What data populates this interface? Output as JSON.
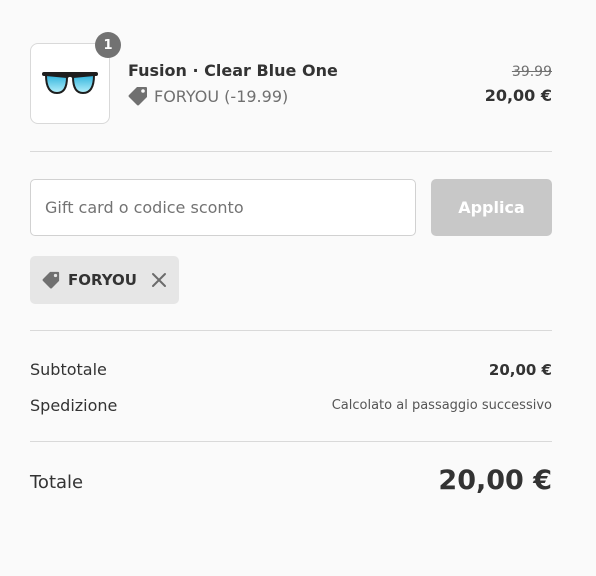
{
  "product": {
    "quantity": "1",
    "name": "Fusion · Clear Blue One",
    "discount_line": "FORYOU (-19.99)",
    "original_price": "39.99",
    "price": "20,00 €",
    "image_icon": "sunglasses-icon"
  },
  "discount": {
    "placeholder": "Gift card o codice sconto",
    "apply_label": "Applica",
    "applied_code": "FORYOU"
  },
  "summary": {
    "subtotal_label": "Subtotale",
    "subtotal_value": "20,00 €",
    "shipping_label": "Spedizione",
    "shipping_value": "Calcolato al passaggio successivo",
    "total_label": "Totale",
    "total_value": "20,00 €"
  },
  "colors": {
    "background": "#fafafa",
    "badge": "#727272",
    "apply_disabled": "#c8c8c8",
    "chip": "#e6e6e6",
    "lens": "#6fd3ec"
  }
}
